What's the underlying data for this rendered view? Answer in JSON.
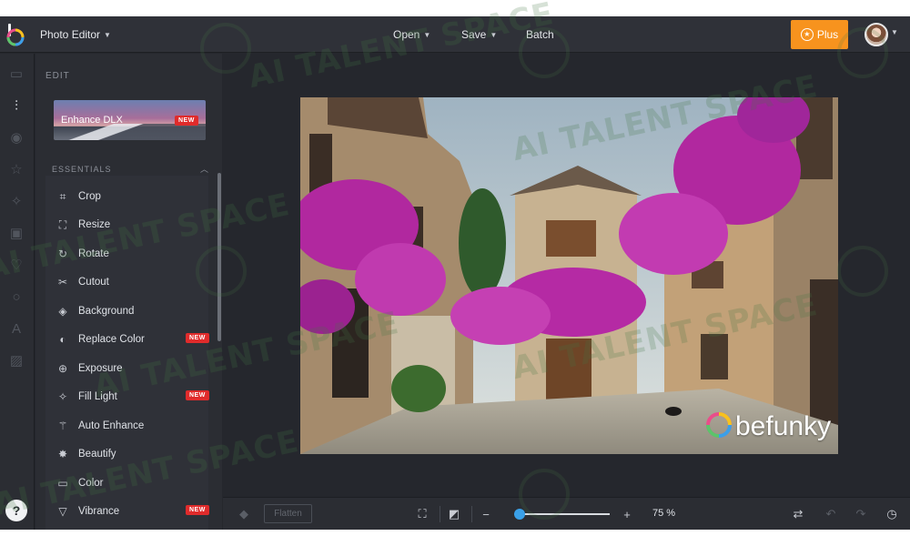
{
  "topbar": {
    "app_title": "Photo Editor",
    "menus": [
      "Open",
      "Save",
      "Batch"
    ],
    "plus_label": "Plus"
  },
  "panel": {
    "title": "EDIT",
    "enhance_card": {
      "label": "Enhance DLX",
      "badge": "NEW"
    },
    "section_header": "ESSENTIALS",
    "items": [
      {
        "label": "Crop",
        "icon": "crop-icon",
        "badge": ""
      },
      {
        "label": "Resize",
        "icon": "resize-icon",
        "badge": ""
      },
      {
        "label": "Rotate",
        "icon": "rotate-icon",
        "badge": ""
      },
      {
        "label": "Cutout",
        "icon": "cutout-icon",
        "badge": ""
      },
      {
        "label": "Background",
        "icon": "background-icon",
        "badge": ""
      },
      {
        "label": "Replace Color",
        "icon": "replace-color-icon",
        "badge": "NEW"
      },
      {
        "label": "Exposure",
        "icon": "exposure-icon",
        "badge": ""
      },
      {
        "label": "Fill Light",
        "icon": "fill-light-icon",
        "badge": "NEW"
      },
      {
        "label": "Auto Enhance",
        "icon": "auto-enhance-icon",
        "badge": ""
      },
      {
        "label": "Beautify",
        "icon": "beautify-icon",
        "badge": ""
      },
      {
        "label": "Color",
        "icon": "color-icon",
        "badge": ""
      },
      {
        "label": "Vibrance",
        "icon": "vibrance-icon",
        "badge": "NEW"
      }
    ]
  },
  "help_label": "?",
  "bottombar": {
    "flatten_label": "Flatten",
    "zoom_level": "75 %",
    "zoom_minus": "−",
    "zoom_plus": "+"
  },
  "photo": {
    "watermark_text": "befunky"
  },
  "watermark_text": "AI TALENT SPACE",
  "colors": {
    "accent": "#f7931e",
    "new_badge": "#e02b2b",
    "slider": "#3aa0e8",
    "bg": "#25272d"
  }
}
